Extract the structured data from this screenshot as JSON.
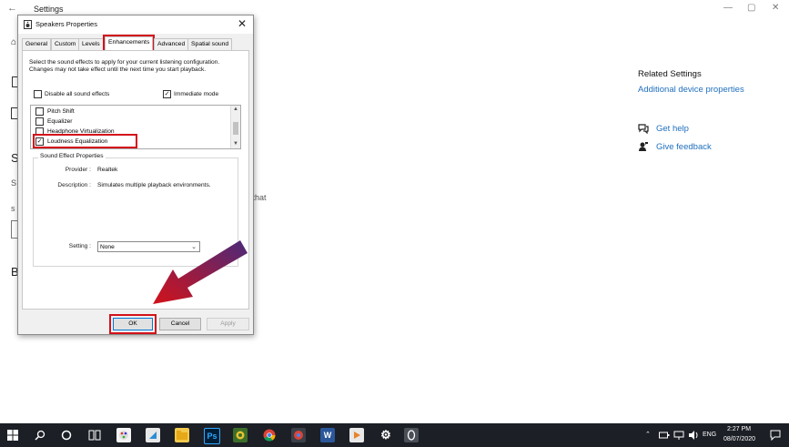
{
  "settings_window": {
    "title": "Settings",
    "stubs": [
      "S",
      "S",
      "s",
      "B"
    ],
    "fragment_text": "e that"
  },
  "related": {
    "title": "Related Settings",
    "link": "Additional device properties"
  },
  "help": {
    "get_help": "Get help",
    "give_feedback": "Give feedback"
  },
  "dialog": {
    "title": "Speakers Properties",
    "close_glyph": "✕",
    "tabs": [
      "General",
      "Custom",
      "Levels",
      "Enhancements",
      "Advanced",
      "Spatial sound"
    ],
    "active_tab": "Enhancements",
    "description": "Select the sound effects to apply for your current listening configuration. Changes may not take effect until the next time you start playback.",
    "disable_all_label": "Disable all sound effects",
    "disable_all_checked": false,
    "immediate_mode_label": "Immediate mode",
    "immediate_mode_checked": true,
    "effects": [
      {
        "label": "Pitch Shift",
        "checked": false
      },
      {
        "label": "Equalizer",
        "checked": false
      },
      {
        "label": "Headphone Virtualization",
        "checked": false
      },
      {
        "label": "Loudness Equalization",
        "checked": true
      }
    ],
    "group_title": "Sound Effect Properties",
    "provider_label": "Provider :",
    "provider_value": "Realtek",
    "description_label": "Description :",
    "description_value": "Simulates multiple playback environments.",
    "setting_label": "Setting :",
    "setting_value": "None",
    "ok": "OK",
    "cancel": "Cancel",
    "apply": "Apply"
  },
  "taskbar": {
    "language": "ENG",
    "time": "2:27 PM",
    "date": "08/07/2020"
  },
  "colors": {
    "highlight_red": "#d3121a",
    "link_blue": "#1f6fbf",
    "taskbar": "#1c1f26"
  }
}
